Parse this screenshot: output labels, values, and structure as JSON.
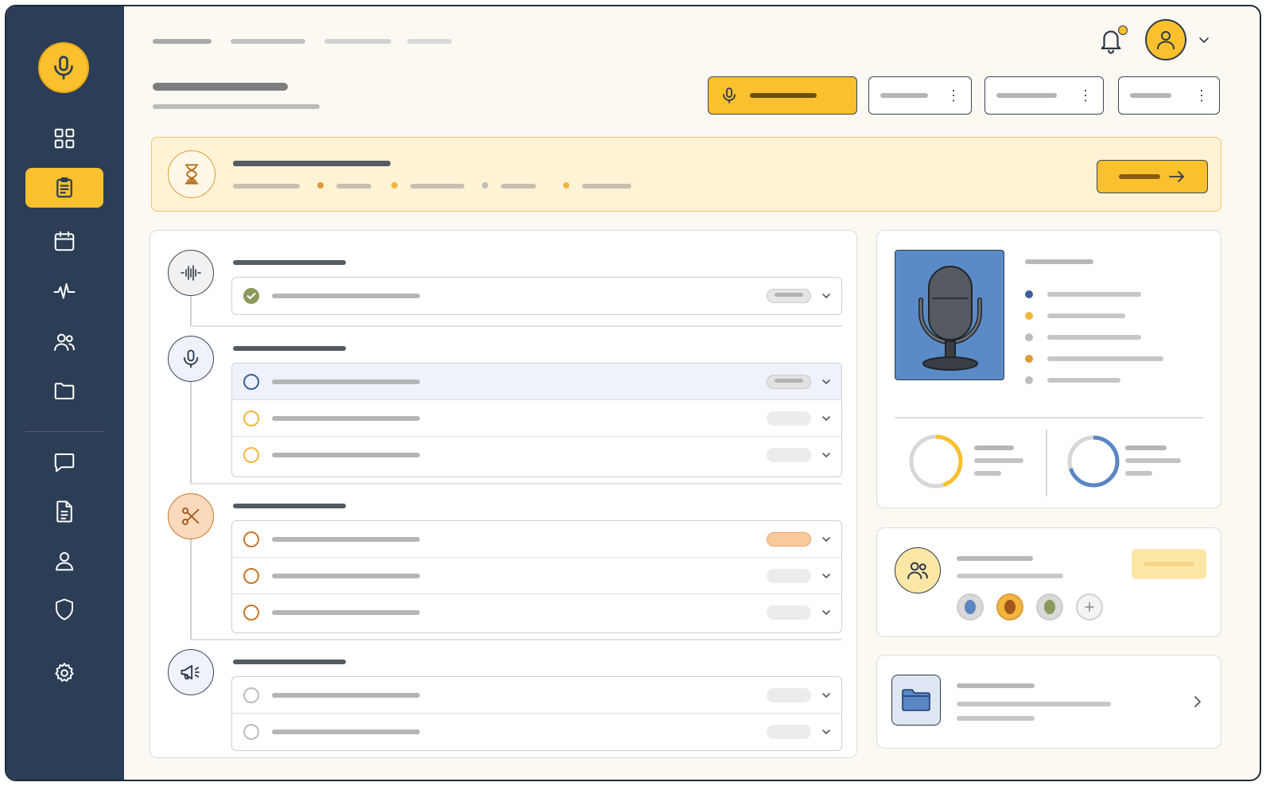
{
  "colors": {
    "sidebar": "#2c3e55",
    "accent": "#fbc02d",
    "banner_bg": "#fff3d6",
    "blue": "#5a86c4",
    "orange": "#e09a3a",
    "olive": "#8a9a5b",
    "grey": "#bdbdbd"
  },
  "sidebar": {
    "logo_icon": "microphone-icon",
    "items": [
      {
        "icon": "grid-icon",
        "active": false
      },
      {
        "icon": "clipboard-icon",
        "active": true
      },
      {
        "icon": "calendar-icon",
        "active": false
      },
      {
        "icon": "waveform-icon",
        "active": false
      },
      {
        "icon": "users-icon",
        "active": false
      },
      {
        "icon": "folder-icon",
        "active": false
      },
      {
        "icon": "chat-icon",
        "active": false
      },
      {
        "icon": "document-icon",
        "active": false
      },
      {
        "icon": "user-icon",
        "active": false
      },
      {
        "icon": "shield-icon",
        "active": false
      },
      {
        "icon": "gear-icon",
        "active": false
      }
    ]
  },
  "header": {
    "notification_icon": "bell-icon",
    "avatar_icon": "user-avatar-icon",
    "toolbar": [
      {
        "kind": "primary",
        "icon": "microphone-icon"
      },
      {
        "kind": "secondary",
        "icon": "more-icon"
      },
      {
        "kind": "secondary",
        "icon": "more-icon"
      },
      {
        "kind": "secondary",
        "icon": "more-icon"
      }
    ]
  },
  "banner": {
    "icon": "hourglass-icon",
    "action_icon": "arrow-right-icon"
  },
  "stages": [
    {
      "icon": "waveform-icon",
      "tasks": [
        {
          "status": "done",
          "color": "#8a9a5b"
        }
      ]
    },
    {
      "icon": "microphone-icon",
      "tasks": [
        {
          "status": "open",
          "color": "#5a86c4",
          "selected": true
        },
        {
          "status": "open",
          "color": "#f2b63d"
        },
        {
          "status": "open",
          "color": "#f2b63d"
        }
      ]
    },
    {
      "icon": "scissors-icon",
      "tasks": [
        {
          "status": "open",
          "color": "#c9762e",
          "tag": "#f9c99c"
        },
        {
          "status": "open",
          "color": "#c9762e"
        },
        {
          "status": "open",
          "color": "#c9762e"
        }
      ]
    },
    {
      "icon": "megaphone-icon",
      "tasks": [
        {
          "status": "open",
          "color": "#bdbdbd"
        },
        {
          "status": "open",
          "color": "#bdbdbd"
        }
      ]
    }
  ],
  "episode_card": {
    "image_icon": "microphone-illustration",
    "legend_colors": [
      "#3f5f9c",
      "#f2b63d",
      "#bdbdbd",
      "#e09a3a",
      "#bdbdbd"
    ],
    "donuts": [
      {
        "color": "#fbc02d",
        "fraction": 0.45
      },
      {
        "color": "#5a86c4",
        "fraction": 0.7
      }
    ]
  },
  "team_card": {
    "icon": "users-icon",
    "avatar_colors": [
      "#5a86c4",
      "#c9762e",
      "#8a9a5b"
    ],
    "add_icon": "plus-icon"
  },
  "files_card": {
    "icon": "folder-icon",
    "action_icon": "chevron-right-icon"
  }
}
